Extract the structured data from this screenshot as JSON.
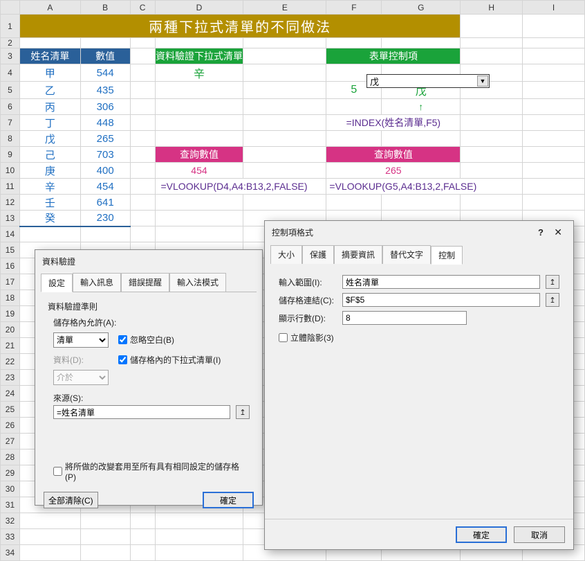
{
  "columns": [
    "A",
    "B",
    "C",
    "D",
    "E",
    "F",
    "G",
    "H",
    "I"
  ],
  "title": "兩種下拉式清單的不同做法",
  "headers": {
    "nameList": "姓名清單",
    "value": "數值",
    "dvDropdown": "資料驗證下拉式清單",
    "formControl": "表單控制項",
    "lookupValue": "查詢數值"
  },
  "data_rows": [
    {
      "name": "甲",
      "val": "544"
    },
    {
      "name": "乙",
      "val": "435"
    },
    {
      "name": "丙",
      "val": "306"
    },
    {
      "name": "丁",
      "val": "448"
    },
    {
      "name": "戊",
      "val": "265"
    },
    {
      "name": "己",
      "val": "703"
    },
    {
      "name": "庚",
      "val": "400"
    },
    {
      "name": "辛",
      "val": "454"
    },
    {
      "name": "壬",
      "val": "641"
    },
    {
      "name": "癸",
      "val": "230"
    }
  ],
  "dv_selected": "辛",
  "fc_selected": "戊",
  "fc_index": "5",
  "fc_result": "戊",
  "index_formula": "=INDEX(姓名清單,F5)",
  "vlookup1_result": "454",
  "vlookup2_result": "265",
  "vlookup1": "=VLOOKUP(D4,A4:B13,2,FALSE)",
  "vlookup2": "=VLOOKUP(G5,A4:B13,2,FALSE)",
  "dialog1": {
    "title": "資料驗證",
    "tabs": [
      "設定",
      "輸入訊息",
      "錯誤提醒",
      "輸入法模式"
    ],
    "section": "資料驗證準則",
    "allow_label": "儲存格內允許(A):",
    "allow_value": "清單",
    "ignore_blank": "忽略空白(B)",
    "in_cell_dropdown": "儲存格內的下拉式清單(I)",
    "data_label": "資料(D):",
    "data_value": "介於",
    "source_label": "來源(S):",
    "source_value": "=姓名清單",
    "apply_all": "將所做的改變套用至所有具有相同設定的儲存格(P)",
    "clear_all": "全部清除(C)",
    "ok": "確定"
  },
  "dialog2": {
    "title": "控制項格式",
    "help": "?",
    "close": "✕",
    "tabs": [
      "大小",
      "保護",
      "摘要資訊",
      "替代文字",
      "控制"
    ],
    "input_range_label": "輸入範圍(I):",
    "input_range_value": "姓名清單",
    "cell_link_label": "儲存格連結(C):",
    "cell_link_value": "$F$5",
    "lines_label": "顯示行數(D):",
    "lines_value": "8",
    "shadow": "立體陰影(3)",
    "ok": "確定",
    "cancel": "取消"
  }
}
